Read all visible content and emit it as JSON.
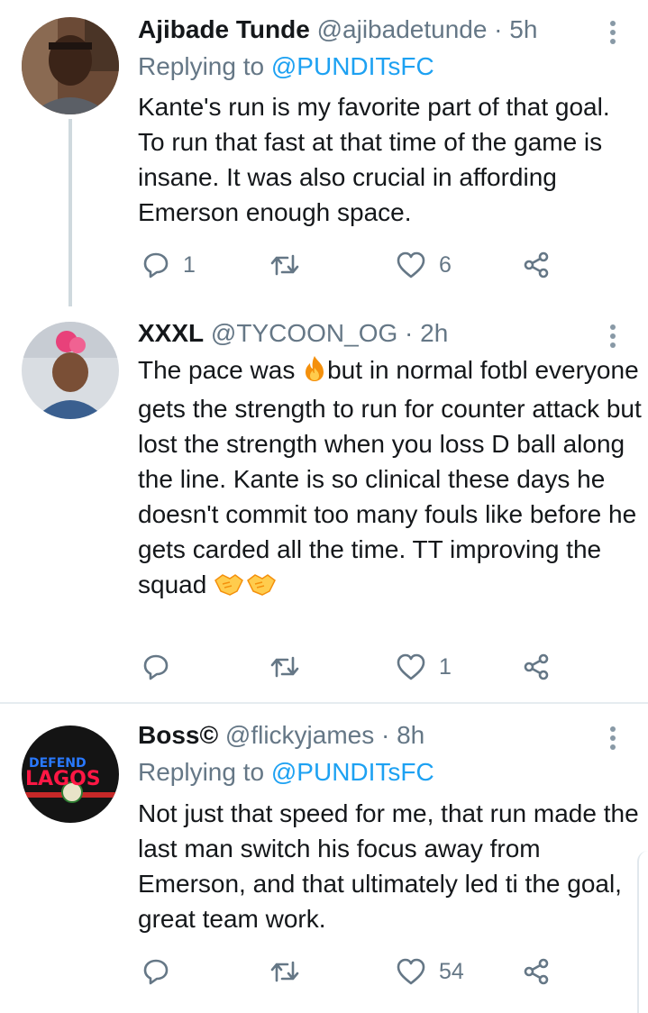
{
  "tweets": [
    {
      "name": "Ajibade Tunde",
      "meta": "@ajibadetunde · 5h",
      "replying_prefix": "Replying to ",
      "replying_handle": "@PUNDITsFC",
      "text": "Kante's run is my favorite part of that goal. To run that fast at that time of the game is insane. It was also crucial in affording Emerson enough space.",
      "counts": {
        "reply": "1",
        "retweet": "",
        "like": "6"
      }
    },
    {
      "name": "XXXL",
      "meta": "@TYCOON_OG · 2h",
      "text_before_emoji": "The pace was ",
      "emoji_1": "fire-emoji",
      "text_after_emoji": "but in normal fotbl everyone gets the strength to run for counter attack but lost the strength when you loss D ball along the line. Kante is so clinical these days he doesn't commit too many fouls like before he gets carded all the time. TT improving the squad ",
      "emoji_2": "handshake-emoji",
      "counts": {
        "reply": "",
        "retweet": "",
        "like": "1"
      }
    },
    {
      "name": "Boss©",
      "meta": "@flickyjames · 8h",
      "replying_prefix": "Replying to ",
      "replying_handle": "@PUNDITsFC",
      "avatar_text_top": "DEFEND",
      "avatar_text_bottom": "LAGOS",
      "text": "Not just that speed for me, that run made the last man switch his focus away from Emerson, and that ultimately led ti the goal,  great team work.",
      "counts": {
        "reply": "",
        "retweet": "",
        "like": "54"
      }
    }
  ],
  "colors": {
    "name": "#14171a",
    "meta": "#657786",
    "link": "#1da1f2",
    "icon": "#657786",
    "divider": "#e6ecf0",
    "thread_line": "#cfd9de"
  }
}
